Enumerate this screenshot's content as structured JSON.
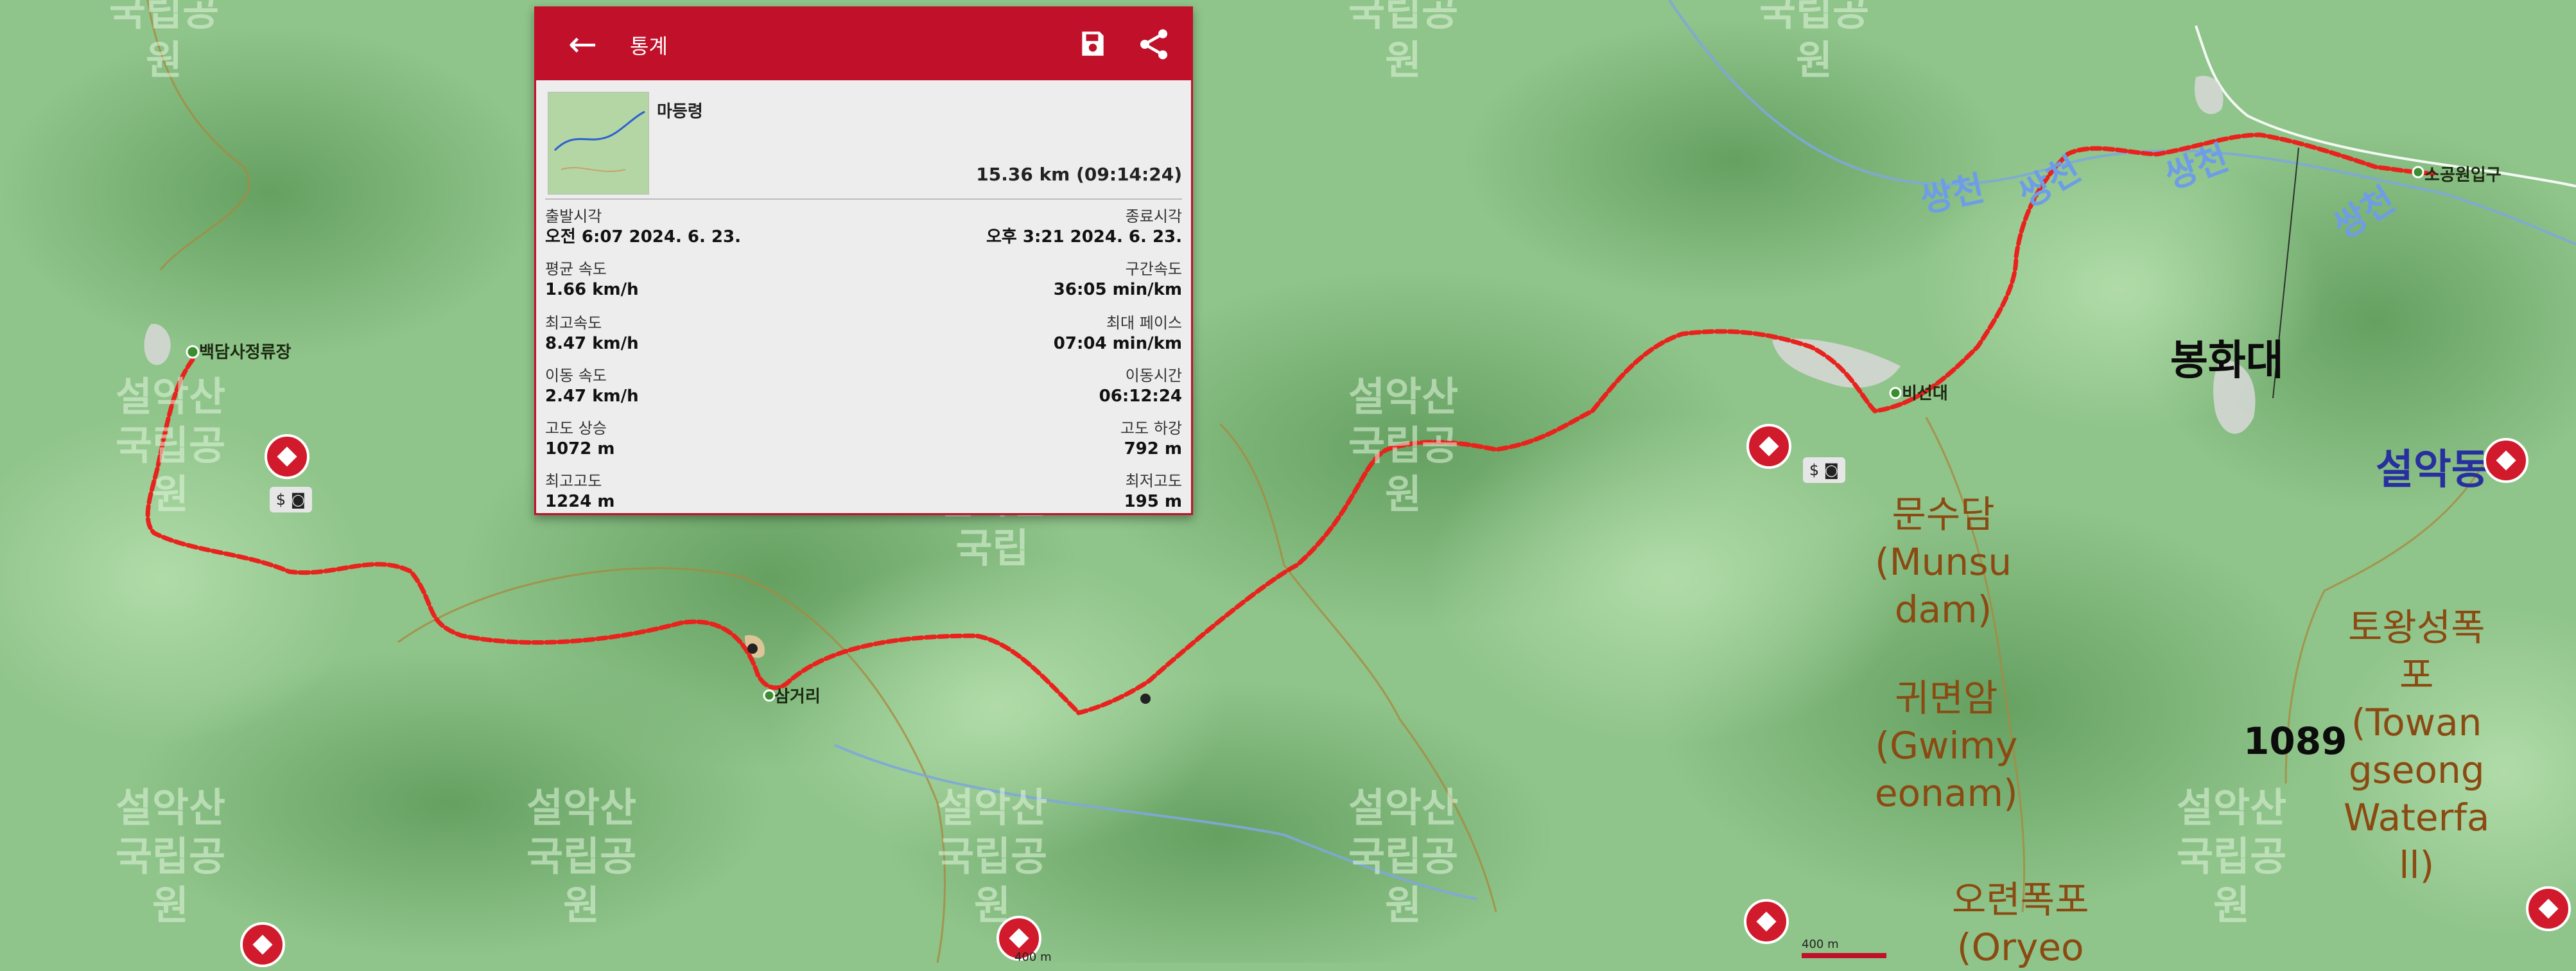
{
  "map": {
    "park_labels": [
      {
        "text": "국립공\n원"
      },
      {
        "text": "국립공\n원"
      },
      {
        "text": "국립공\n원"
      },
      {
        "text": "설악산\n국립공\n원"
      },
      {
        "text": "설악산\n국립공\n원"
      },
      {
        "text": "설악산\n국립공\n원"
      },
      {
        "text": "설악산\n국립공\n원"
      },
      {
        "text": "설악산\n국립공\n원"
      },
      {
        "text": "설악산\n국립공\n원"
      },
      {
        "text": "설악산\n국립공\n원"
      },
      {
        "text": "설악산\n국립"
      }
    ],
    "places": {
      "munsudam": "문수담\n(Munsu\ndam)",
      "gwimyeonam": "귀면암\n(Gwimy\neonam)",
      "oryeon": "오련폭포\n(Oryeo",
      "towang": "토왕성폭\n포\n(Towan\ngseong\nWaterfa\nll)"
    },
    "poi": {
      "baekdam": "백담사정류장",
      "samgeori": "삼거리",
      "biseondae": "비선대",
      "sogongwon": "소공원입구"
    },
    "river_labels": [
      "쌍천",
      "쌍천",
      "쌍천",
      "쌍천"
    ],
    "peak_bonghwadae": "봉화대",
    "area_seorakdong": "설악동",
    "elevation": "1089",
    "scale_label": "400 m",
    "route_color": "#e8221c"
  },
  "stats": {
    "title": "통계",
    "back_icon": "arrow-back-icon",
    "save_icon": "save-icon",
    "share_icon": "share-icon",
    "route_name": "마등령",
    "distance": "15.36 km (09:14:24)",
    "start_time_label": "출발시각",
    "start_time": "오전 6:07 2024. 6. 23.",
    "end_time_label": "종료시각",
    "end_time": "오후 3:21 2024. 6. 23.",
    "avg_speed_label": "평균 속도",
    "avg_speed": "1.66 km/h",
    "pace_label": "구간속도",
    "pace": "36:05 min/km",
    "max_speed_label": "최고속도",
    "max_speed": "8.47 km/h",
    "max_pace_label": "최대 페이스",
    "max_pace": "07:04 min/km",
    "moving_speed_label": "이동 속도",
    "moving_speed": "2.47 km/h",
    "moving_time_label": "이동시간",
    "moving_time": "06:12:24",
    "ascent_label": "고도 상승",
    "ascent": "1072 m",
    "descent_label": "고도 하강",
    "descent": "792 m",
    "max_alt_label": "최고고도",
    "max_alt": "1224 m",
    "min_alt_label": "최저고도",
    "min_alt": "195 m"
  }
}
